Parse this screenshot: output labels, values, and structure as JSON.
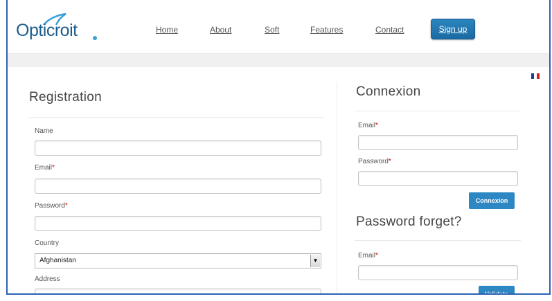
{
  "brand": {
    "logo_text": "Opticroit"
  },
  "nav": {
    "items": [
      "Home",
      "About",
      "Soft",
      "Features",
      "Contact"
    ],
    "signup_label": "Sign up"
  },
  "language_flag": "french-flag-icon",
  "registration": {
    "title": "Registration",
    "name_label": "Name",
    "email_label": "Email",
    "password_label": "Password",
    "country_label": "Country",
    "country_value": "Afghanistan",
    "address_label": "Address",
    "required_mark": "*"
  },
  "connexion": {
    "title": "Connexion",
    "email_label": "Email",
    "password_label": "Password",
    "button_label": "Connexion",
    "required_mark": "*"
  },
  "forgot": {
    "title": "Password forget?",
    "email_label": "Email",
    "button_label": "Validate",
    "required_mark": "*"
  },
  "colors": {
    "brand_blue": "#1d5d8c",
    "accent": "#2d87c2",
    "required": "#cc0000",
    "frame": "#2a62b4"
  }
}
